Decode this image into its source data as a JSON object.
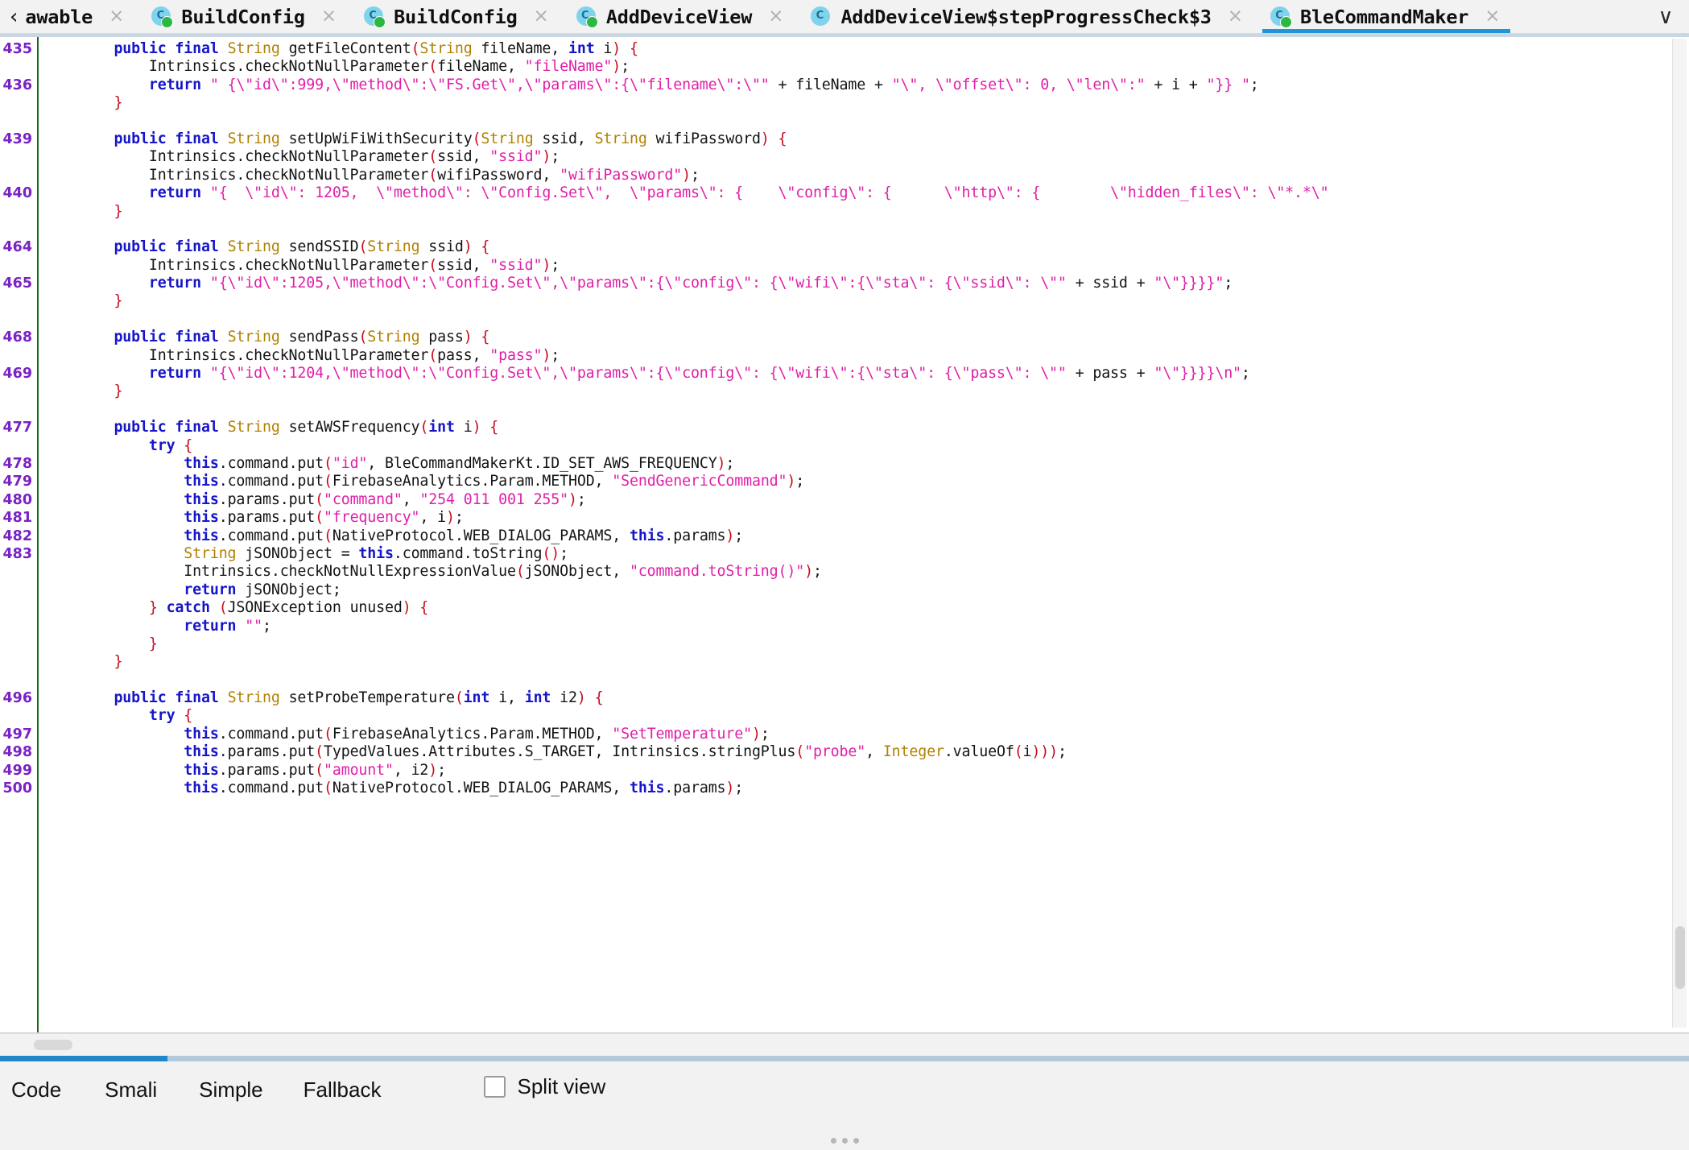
{
  "tabbar": {
    "back_chevron": "‹",
    "overflow_chevron": "∨",
    "close_glyph": "×",
    "tabs": [
      {
        "label": "awable",
        "icon": "back-chevron",
        "closable": true,
        "active": false
      },
      {
        "label": "BuildConfig",
        "icon": "class-icon",
        "closable": true,
        "active": false
      },
      {
        "label": "BuildConfig",
        "icon": "class-icon",
        "closable": true,
        "active": false
      },
      {
        "label": "AddDeviceView",
        "icon": "class-icon",
        "closable": true,
        "active": false
      },
      {
        "label": "AddDeviceView$stepProgressCheck$3",
        "icon": "class-icon-plain",
        "closable": true,
        "active": false
      },
      {
        "label": "BleCommandMaker",
        "icon": "class-icon",
        "closable": true,
        "active": true
      }
    ]
  },
  "editor": {
    "language": "java",
    "gutter": [
      "435",
      "",
      "436",
      "",
      "",
      "439",
      "",
      "",
      "440",
      "",
      "",
      "464",
      "",
      "465",
      "",
      "",
      "468",
      "",
      "469",
      "",
      "",
      "477",
      "",
      "478",
      "479",
      "480",
      "481",
      "482",
      "483",
      "",
      "",
      "",
      "",
      "",
      "",
      "",
      "496",
      "",
      "497",
      "498",
      "499",
      "500"
    ],
    "lines": [
      [
        {
          "t": "    ",
          "c": "n"
        },
        {
          "t": "public final ",
          "c": "k"
        },
        {
          "t": "String",
          "c": "t"
        },
        {
          "t": " getFileContent",
          "c": "n"
        },
        {
          "t": "(",
          "c": "p"
        },
        {
          "t": "String",
          "c": "t"
        },
        {
          "t": " fileName, ",
          "c": "n"
        },
        {
          "t": "int",
          "c": "k"
        },
        {
          "t": " i",
          "c": "n"
        },
        {
          "t": ")",
          "c": "p"
        },
        {
          "t": " {",
          "c": "p"
        }
      ],
      [
        {
          "t": "        Intrinsics.checkNotNullParameter",
          "c": "n"
        },
        {
          "t": "(",
          "c": "p"
        },
        {
          "t": "fileName, ",
          "c": "n"
        },
        {
          "t": "\"fileName\"",
          "c": "s"
        },
        {
          "t": ")",
          "c": "p"
        },
        {
          "t": ";",
          "c": "n"
        }
      ],
      [
        {
          "t": "        ",
          "c": "n"
        },
        {
          "t": "return",
          "c": "k"
        },
        {
          "t": " ",
          "c": "n"
        },
        {
          "t": "\" {\\\"id\\\":999,\\\"method\\\":\\\"FS.Get\\\",\\\"params\\\":{\\\"filename\\\":\\\"\"",
          "c": "s"
        },
        {
          "t": " + fileName + ",
          "c": "n"
        },
        {
          "t": "\"\\\", \\\"offset\\\": 0, \\\"len\\\":\"",
          "c": "s"
        },
        {
          "t": " + i + ",
          "c": "n"
        },
        {
          "t": "\"}} \"",
          "c": "s"
        },
        {
          "t": ";",
          "c": "n"
        }
      ],
      [
        {
          "t": "    ",
          "c": "n"
        },
        {
          "t": "}",
          "c": "p"
        }
      ],
      [
        {
          "t": "",
          "c": "n"
        }
      ],
      [
        {
          "t": "    ",
          "c": "n"
        },
        {
          "t": "public final ",
          "c": "k"
        },
        {
          "t": "String",
          "c": "t"
        },
        {
          "t": " setUpWiFiWithSecurity",
          "c": "n"
        },
        {
          "t": "(",
          "c": "p"
        },
        {
          "t": "String",
          "c": "t"
        },
        {
          "t": " ssid, ",
          "c": "n"
        },
        {
          "t": "String",
          "c": "t"
        },
        {
          "t": " wifiPassword",
          "c": "n"
        },
        {
          "t": ")",
          "c": "p"
        },
        {
          "t": " {",
          "c": "p"
        }
      ],
      [
        {
          "t": "        Intrinsics.checkNotNullParameter",
          "c": "n"
        },
        {
          "t": "(",
          "c": "p"
        },
        {
          "t": "ssid, ",
          "c": "n"
        },
        {
          "t": "\"ssid\"",
          "c": "s"
        },
        {
          "t": ")",
          "c": "p"
        },
        {
          "t": ";",
          "c": "n"
        }
      ],
      [
        {
          "t": "        Intrinsics.checkNotNullParameter",
          "c": "n"
        },
        {
          "t": "(",
          "c": "p"
        },
        {
          "t": "wifiPassword, ",
          "c": "n"
        },
        {
          "t": "\"wifiPassword\"",
          "c": "s"
        },
        {
          "t": ")",
          "c": "p"
        },
        {
          "t": ";",
          "c": "n"
        }
      ],
      [
        {
          "t": "        ",
          "c": "n"
        },
        {
          "t": "return",
          "c": "k"
        },
        {
          "t": " ",
          "c": "n"
        },
        {
          "t": "\"{  \\\"id\\\": 1205,  \\\"method\\\": \\\"Config.Set\\\",  \\\"params\\\": {    \\\"config\\\": {      \\\"http\\\": {        \\\"hidden_files\\\": \\\"*.*\\\"",
          "c": "s"
        }
      ],
      [
        {
          "t": "    ",
          "c": "n"
        },
        {
          "t": "}",
          "c": "p"
        }
      ],
      [
        {
          "t": "",
          "c": "n"
        }
      ],
      [
        {
          "t": "    ",
          "c": "n"
        },
        {
          "t": "public final ",
          "c": "k"
        },
        {
          "t": "String",
          "c": "t"
        },
        {
          "t": " sendSSID",
          "c": "n"
        },
        {
          "t": "(",
          "c": "p"
        },
        {
          "t": "String",
          "c": "t"
        },
        {
          "t": " ssid",
          "c": "n"
        },
        {
          "t": ")",
          "c": "p"
        },
        {
          "t": " {",
          "c": "p"
        }
      ],
      [
        {
          "t": "        Intrinsics.checkNotNullParameter",
          "c": "n"
        },
        {
          "t": "(",
          "c": "p"
        },
        {
          "t": "ssid, ",
          "c": "n"
        },
        {
          "t": "\"ssid\"",
          "c": "s"
        },
        {
          "t": ")",
          "c": "p"
        },
        {
          "t": ";",
          "c": "n"
        }
      ],
      [
        {
          "t": "        ",
          "c": "n"
        },
        {
          "t": "return",
          "c": "k"
        },
        {
          "t": " ",
          "c": "n"
        },
        {
          "t": "\"{\\\"id\\\":1205,\\\"method\\\":\\\"Config.Set\\\",\\\"params\\\":{\\\"config\\\": {\\\"wifi\\\":{\\\"sta\\\": {\\\"ssid\\\": \\\"\"",
          "c": "s"
        },
        {
          "t": " + ssid + ",
          "c": "n"
        },
        {
          "t": "\"\\\"}}}}\"",
          "c": "s"
        },
        {
          "t": ";",
          "c": "n"
        }
      ],
      [
        {
          "t": "    ",
          "c": "n"
        },
        {
          "t": "}",
          "c": "p"
        }
      ],
      [
        {
          "t": "",
          "c": "n"
        }
      ],
      [
        {
          "t": "    ",
          "c": "n"
        },
        {
          "t": "public final ",
          "c": "k"
        },
        {
          "t": "String",
          "c": "t"
        },
        {
          "t": " sendPass",
          "c": "n"
        },
        {
          "t": "(",
          "c": "p"
        },
        {
          "t": "String",
          "c": "t"
        },
        {
          "t": " pass",
          "c": "n"
        },
        {
          "t": ")",
          "c": "p"
        },
        {
          "t": " {",
          "c": "p"
        }
      ],
      [
        {
          "t": "        Intrinsics.checkNotNullParameter",
          "c": "n"
        },
        {
          "t": "(",
          "c": "p"
        },
        {
          "t": "pass, ",
          "c": "n"
        },
        {
          "t": "\"pass\"",
          "c": "s"
        },
        {
          "t": ")",
          "c": "p"
        },
        {
          "t": ";",
          "c": "n"
        }
      ],
      [
        {
          "t": "        ",
          "c": "n"
        },
        {
          "t": "return",
          "c": "k"
        },
        {
          "t": " ",
          "c": "n"
        },
        {
          "t": "\"{\\\"id\\\":1204,\\\"method\\\":\\\"Config.Set\\\",\\\"params\\\":{\\\"config\\\": {\\\"wifi\\\":{\\\"sta\\\": {\\\"pass\\\": \\\"\"",
          "c": "s"
        },
        {
          "t": " + pass + ",
          "c": "n"
        },
        {
          "t": "\"\\\"}}}}\\n\"",
          "c": "s"
        },
        {
          "t": ";",
          "c": "n"
        }
      ],
      [
        {
          "t": "    ",
          "c": "n"
        },
        {
          "t": "}",
          "c": "p"
        }
      ],
      [
        {
          "t": "",
          "c": "n"
        }
      ],
      [
        {
          "t": "    ",
          "c": "n"
        },
        {
          "t": "public final ",
          "c": "k"
        },
        {
          "t": "String",
          "c": "t"
        },
        {
          "t": " setAWSFrequency",
          "c": "n"
        },
        {
          "t": "(",
          "c": "p"
        },
        {
          "t": "int",
          "c": "k"
        },
        {
          "t": " i",
          "c": "n"
        },
        {
          "t": ")",
          "c": "p"
        },
        {
          "t": " {",
          "c": "p"
        }
      ],
      [
        {
          "t": "        ",
          "c": "n"
        },
        {
          "t": "try",
          "c": "k"
        },
        {
          "t": " {",
          "c": "p"
        }
      ],
      [
        {
          "t": "            ",
          "c": "n"
        },
        {
          "t": "this",
          "c": "k"
        },
        {
          "t": ".command.put",
          "c": "n"
        },
        {
          "t": "(",
          "c": "p"
        },
        {
          "t": "\"id\"",
          "c": "s"
        },
        {
          "t": ", BleCommandMakerKt.ID_SET_AWS_FREQUENCY",
          "c": "n"
        },
        {
          "t": ")",
          "c": "p"
        },
        {
          "t": ";",
          "c": "n"
        }
      ],
      [
        {
          "t": "            ",
          "c": "n"
        },
        {
          "t": "this",
          "c": "k"
        },
        {
          "t": ".command.put",
          "c": "n"
        },
        {
          "t": "(",
          "c": "p"
        },
        {
          "t": "FirebaseAnalytics.Param.METHOD, ",
          "c": "n"
        },
        {
          "t": "\"SendGenericCommand\"",
          "c": "s"
        },
        {
          "t": ")",
          "c": "p"
        },
        {
          "t": ";",
          "c": "n"
        }
      ],
      [
        {
          "t": "            ",
          "c": "n"
        },
        {
          "t": "this",
          "c": "k"
        },
        {
          "t": ".params.put",
          "c": "n"
        },
        {
          "t": "(",
          "c": "p"
        },
        {
          "t": "\"command\"",
          "c": "s"
        },
        {
          "t": ", ",
          "c": "n"
        },
        {
          "t": "\"254 011 001 255\"",
          "c": "s"
        },
        {
          "t": ")",
          "c": "p"
        },
        {
          "t": ";",
          "c": "n"
        }
      ],
      [
        {
          "t": "            ",
          "c": "n"
        },
        {
          "t": "this",
          "c": "k"
        },
        {
          "t": ".params.put",
          "c": "n"
        },
        {
          "t": "(",
          "c": "p"
        },
        {
          "t": "\"frequency\"",
          "c": "s"
        },
        {
          "t": ", i",
          "c": "n"
        },
        {
          "t": ")",
          "c": "p"
        },
        {
          "t": ";",
          "c": "n"
        }
      ],
      [
        {
          "t": "            ",
          "c": "n"
        },
        {
          "t": "this",
          "c": "k"
        },
        {
          "t": ".command.put",
          "c": "n"
        },
        {
          "t": "(",
          "c": "p"
        },
        {
          "t": "NativeProtocol.WEB_DIALOG_PARAMS, ",
          "c": "n"
        },
        {
          "t": "this",
          "c": "k"
        },
        {
          "t": ".params",
          "c": "n"
        },
        {
          "t": ")",
          "c": "p"
        },
        {
          "t": ";",
          "c": "n"
        }
      ],
      [
        {
          "t": "            ",
          "c": "n"
        },
        {
          "t": "String",
          "c": "t"
        },
        {
          "t": " jSONObject = ",
          "c": "n"
        },
        {
          "t": "this",
          "c": "k"
        },
        {
          "t": ".command.toString",
          "c": "n"
        },
        {
          "t": "()",
          "c": "p"
        },
        {
          "t": ";",
          "c": "n"
        }
      ],
      [
        {
          "t": "            Intrinsics.checkNotNullExpressionValue",
          "c": "n"
        },
        {
          "t": "(",
          "c": "p"
        },
        {
          "t": "jSONObject, ",
          "c": "n"
        },
        {
          "t": "\"command.toString()\"",
          "c": "s"
        },
        {
          "t": ")",
          "c": "p"
        },
        {
          "t": ";",
          "c": "n"
        }
      ],
      [
        {
          "t": "            ",
          "c": "n"
        },
        {
          "t": "return",
          "c": "k"
        },
        {
          "t": " jSONObject;",
          "c": "n"
        }
      ],
      [
        {
          "t": "        ",
          "c": "n"
        },
        {
          "t": "}",
          "c": "p"
        },
        {
          "t": " ",
          "c": "n"
        },
        {
          "t": "catch",
          "c": "k"
        },
        {
          "t": " ",
          "c": "n"
        },
        {
          "t": "(",
          "c": "p"
        },
        {
          "t": "JSONException unused",
          "c": "n"
        },
        {
          "t": ")",
          "c": "p"
        },
        {
          "t": " {",
          "c": "p"
        }
      ],
      [
        {
          "t": "            ",
          "c": "n"
        },
        {
          "t": "return",
          "c": "k"
        },
        {
          "t": " ",
          "c": "n"
        },
        {
          "t": "\"\"",
          "c": "s"
        },
        {
          "t": ";",
          "c": "n"
        }
      ],
      [
        {
          "t": "        ",
          "c": "n"
        },
        {
          "t": "}",
          "c": "p"
        }
      ],
      [
        {
          "t": "    ",
          "c": "n"
        },
        {
          "t": "}",
          "c": "p"
        }
      ],
      [
        {
          "t": "",
          "c": "n"
        }
      ],
      [
        {
          "t": "    ",
          "c": "n"
        },
        {
          "t": "public final ",
          "c": "k"
        },
        {
          "t": "String",
          "c": "t"
        },
        {
          "t": " setProbeTemperature",
          "c": "n"
        },
        {
          "t": "(",
          "c": "p"
        },
        {
          "t": "int",
          "c": "k"
        },
        {
          "t": " i, ",
          "c": "n"
        },
        {
          "t": "int",
          "c": "k"
        },
        {
          "t": " i2",
          "c": "n"
        },
        {
          "t": ")",
          "c": "p"
        },
        {
          "t": " {",
          "c": "p"
        }
      ],
      [
        {
          "t": "        ",
          "c": "n"
        },
        {
          "t": "try",
          "c": "k"
        },
        {
          "t": " {",
          "c": "p"
        }
      ],
      [
        {
          "t": "            ",
          "c": "n"
        },
        {
          "t": "this",
          "c": "k"
        },
        {
          "t": ".command.put",
          "c": "n"
        },
        {
          "t": "(",
          "c": "p"
        },
        {
          "t": "FirebaseAnalytics.Param.METHOD, ",
          "c": "n"
        },
        {
          "t": "\"SetTemperature\"",
          "c": "s"
        },
        {
          "t": ")",
          "c": "p"
        },
        {
          "t": ";",
          "c": "n"
        }
      ],
      [
        {
          "t": "            ",
          "c": "n"
        },
        {
          "t": "this",
          "c": "k"
        },
        {
          "t": ".params.put",
          "c": "n"
        },
        {
          "t": "(",
          "c": "p"
        },
        {
          "t": "TypedValues.Attributes.S_TARGET, Intrinsics.stringPlus",
          "c": "n"
        },
        {
          "t": "(",
          "c": "p"
        },
        {
          "t": "\"probe\"",
          "c": "s"
        },
        {
          "t": ", ",
          "c": "n"
        },
        {
          "t": "Integer",
          "c": "t"
        },
        {
          "t": ".valueOf",
          "c": "n"
        },
        {
          "t": "(",
          "c": "p"
        },
        {
          "t": "i",
          "c": "n"
        },
        {
          "t": ")))",
          "c": "p"
        },
        {
          "t": ";",
          "c": "n"
        }
      ],
      [
        {
          "t": "            ",
          "c": "n"
        },
        {
          "t": "this",
          "c": "k"
        },
        {
          "t": ".params.put",
          "c": "n"
        },
        {
          "t": "(",
          "c": "p"
        },
        {
          "t": "\"amount\"",
          "c": "s"
        },
        {
          "t": ", i2",
          "c": "n"
        },
        {
          "t": ")",
          "c": "p"
        },
        {
          "t": ";",
          "c": "n"
        }
      ],
      [
        {
          "t": "            ",
          "c": "n"
        },
        {
          "t": "this",
          "c": "k"
        },
        {
          "t": ".command.put",
          "c": "n"
        },
        {
          "t": "(",
          "c": "p"
        },
        {
          "t": "NativeProtocol.WEB_DIALOG_PARAMS, ",
          "c": "n"
        },
        {
          "t": "this",
          "c": "k"
        },
        {
          "t": ".params",
          "c": "n"
        },
        {
          "t": ")",
          "c": "p"
        },
        {
          "t": ";",
          "c": "n"
        }
      ]
    ]
  },
  "bottombar": {
    "mode_tabs": [
      {
        "label": "Code",
        "active": true
      },
      {
        "label": "Smali",
        "active": false
      },
      {
        "label": "Simple",
        "active": false
      },
      {
        "label": "Fallback",
        "active": false
      }
    ],
    "split_view_label": "Split view",
    "split_view_checked": false
  },
  "colors": {
    "accent": "#1f87c7",
    "keyword": "#1616c8",
    "string": "#e01fa8",
    "type": "#b08000",
    "punctuation": "#c40c1e",
    "line_number": "#7a22c4",
    "gutter_rule": "#196b1e",
    "chrome": "#f2f2f2"
  }
}
